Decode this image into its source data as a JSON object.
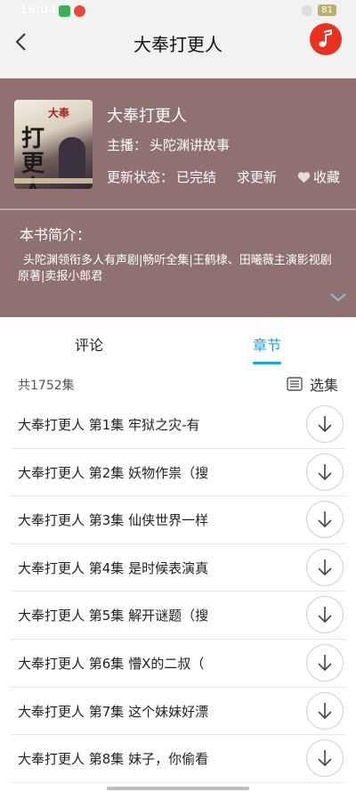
{
  "status_bar": {
    "time": "16:04",
    "battery": "81"
  },
  "header": {
    "title": "大奉打更人"
  },
  "book": {
    "cover_script": "打更人",
    "cover_tag": "大奉",
    "title": "大奉打更人",
    "anchor_label": "主播：",
    "anchor": "头陀渊讲故事",
    "update_label": "更新状态：",
    "update_status": "已完结",
    "request_update": "求更新",
    "favorite": "收藏",
    "intro_label": "本书简介：",
    "intro": "头陀渊领衔多人有声剧|畅听全集|王鹤棣、田曦薇主演影视剧原著|卖报小郎君"
  },
  "tabs": [
    {
      "label": "评论",
      "active": false
    },
    {
      "label": "章节",
      "active": true
    }
  ],
  "episodes_header": {
    "count": "共1752集",
    "select": "选集"
  },
  "episodes": [
    {
      "title": "大奉打更人 第1集 牢狱之灾-有"
    },
    {
      "title": "大奉打更人 第2集 妖物作祟（搜"
    },
    {
      "title": "大奉打更人 第3集 仙侠世界一样"
    },
    {
      "title": "大奉打更人 第4集 是时候表演真"
    },
    {
      "title": "大奉打更人 第5集 解开谜题（搜"
    },
    {
      "title": "大奉打更人 第6集 懵X的二叔（"
    },
    {
      "title": "大奉打更人 第7集 这个妹妹好漂"
    },
    {
      "title": "大奉打更人 第8集 妹子，你偷看"
    }
  ],
  "colors": {
    "accent": "#1aa6e0",
    "panel": "#8e7170",
    "music": "#e8311f"
  }
}
